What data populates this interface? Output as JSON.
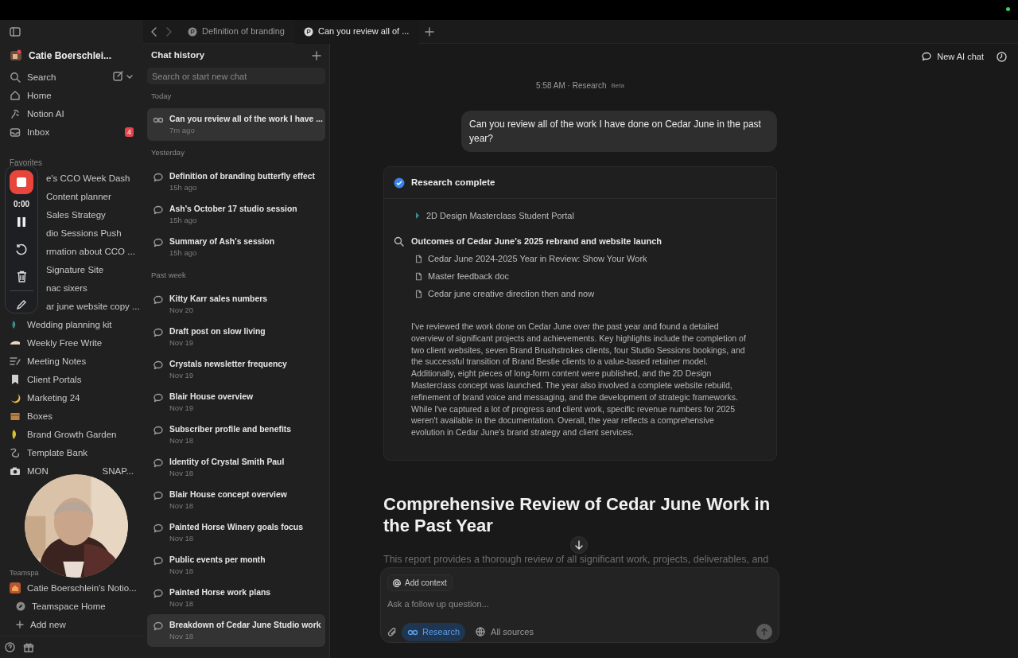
{
  "tabs": [
    {
      "label": "Definition of branding",
      "selected": false
    },
    {
      "label": "Can you review all of ...",
      "selected": true
    }
  ],
  "sidebar": {
    "workspace": "Catie Boerschlei...",
    "nav": [
      {
        "label": "Search"
      },
      {
        "label": "Home"
      },
      {
        "label": "Notion AI"
      },
      {
        "label": "Inbox",
        "badge": "4"
      }
    ],
    "favorites_heading": "Favorites",
    "favorites": [
      {
        "kind": "covered",
        "label": "e's CCO Week Dash"
      },
      {
        "kind": "covered",
        "label": "Content planner"
      },
      {
        "kind": "covered",
        "label": "Sales Strategy"
      },
      {
        "kind": "covered",
        "label": "dio Sessions Push"
      },
      {
        "kind": "covered",
        "label": "rmation about CCO ..."
      },
      {
        "kind": "covered",
        "label": "Signature Site"
      },
      {
        "kind": "covered",
        "label": "nac sixers"
      },
      {
        "kind": "covered",
        "label": "ar june website copy ..."
      },
      {
        "kind": "page",
        "label": "Wedding planning kit"
      },
      {
        "kind": "page",
        "label": "Weekly Free Write"
      },
      {
        "kind": "page",
        "label": "Meeting Notes"
      },
      {
        "kind": "page",
        "label": "Client Portals"
      },
      {
        "kind": "page",
        "label": "Marketing 24"
      },
      {
        "kind": "page",
        "label": "Boxes"
      },
      {
        "kind": "page",
        "label": "Brand Growth Garden"
      },
      {
        "kind": "page",
        "label": "Template Bank"
      },
      {
        "kind": "split",
        "label": "MON",
        "label_end": "SNAP..."
      }
    ],
    "teamspaces_heading": "Teamspa",
    "teamspaces": [
      {
        "label": "Catie Boerschlein's Notio...",
        "children": [
          {
            "label": "Teamspace Home"
          }
        ]
      }
    ],
    "add_new": "Add new"
  },
  "recorder": {
    "time": "0:00"
  },
  "chat_history": {
    "title": "Chat history",
    "search": {
      "placeholder": "Search or start new chat"
    },
    "groups": [
      {
        "heading": "Today",
        "items": [
          {
            "kind": "research",
            "title": "Can you review all of the work I have ...",
            "time": "7m ago",
            "selected": true
          }
        ]
      },
      {
        "heading": "Yesterday",
        "items": [
          {
            "kind": "chat",
            "title": "Definition of branding butterfly effect",
            "time": "15h ago",
            "selected": false
          },
          {
            "kind": "chat",
            "title": "Ash's October 17 studio session",
            "time": "15h ago",
            "selected": false
          },
          {
            "kind": "chat",
            "title": "Summary of Ash's session",
            "time": "15h ago",
            "selected": false
          }
        ]
      },
      {
        "heading": "Past week",
        "items": [
          {
            "kind": "chat",
            "title": "Kitty Karr sales numbers",
            "time": "Nov 20",
            "selected": false
          },
          {
            "kind": "chat",
            "title": "Draft post on slow living",
            "time": "Nov 19",
            "selected": false
          },
          {
            "kind": "chat",
            "title": "Crystals newsletter frequency",
            "time": "Nov 19",
            "selected": false
          },
          {
            "kind": "chat",
            "title": "Blair House overview",
            "time": "Nov 19",
            "selected": false
          },
          {
            "kind": "chat",
            "title": "Subscriber profile and benefits",
            "time": "Nov 18",
            "selected": false
          },
          {
            "kind": "chat",
            "title": "Identity of Crystal Smith Paul",
            "time": "Nov 18",
            "selected": false
          },
          {
            "kind": "chat",
            "title": "Blair House concept overview",
            "time": "Nov 18",
            "selected": false
          },
          {
            "kind": "chat",
            "title": "Painted Horse Winery goals focus",
            "time": "Nov 18",
            "selected": false
          },
          {
            "kind": "chat",
            "title": "Public events per month",
            "time": "Nov 18",
            "selected": false
          },
          {
            "kind": "chat",
            "title": "Painted Horse work plans",
            "time": "Nov 18",
            "selected": false
          },
          {
            "kind": "chat",
            "title": "Breakdown of Cedar June Studio work",
            "time": "Nov 18",
            "selected": true
          }
        ]
      }
    ]
  },
  "main": {
    "new_chat": "New AI chat",
    "meta": "5:58 AM · Research",
    "meta_badge": "Beta",
    "user_message": "Can you review all of the work I have done on Cedar June in the past year?",
    "research": {
      "status": "Research complete",
      "complete": true,
      "results": [
        {
          "kind": "page",
          "label": "2D Design Masterclass Student Portal"
        }
      ],
      "searches": [
        {
          "query": "Outcomes of Cedar June's 2025 rebrand and website launch",
          "results": [
            {
              "kind": "doc",
              "label": "Cedar June 2024-2025 Year in Review: Show Your Work"
            },
            {
              "kind": "doc",
              "label": "Master feedback doc"
            },
            {
              "kind": "doc",
              "label": "Cedar june creative direction then and now"
            }
          ]
        }
      ],
      "summary": "I've reviewed the work done on Cedar June over the past year and found a detailed overview of significant projects and achievements. Key highlights include the completion of two client websites, seven Brand Brushstrokes clients, four Studio Sessions bookings, and the successful transition of Brand Bestie clients to a value-based retainer model. Additionally, eight pieces of long-form content were published, and the 2D Design Masterclass concept was launched. The year also involved a complete website rebuild, refinement of brand voice and messaging, and the development of strategic frameworks. While I've captured a lot of progress and client work, specific revenue numbers for 2025 weren't available in the documentation. Overall, the year reflects a comprehensive evolution in Cedar June's brand strategy and client services."
    },
    "report": {
      "title": "Comprehensive Review of Cedar June Work in the Past Year",
      "intro": "This report provides a thorough review of all significant work, projects, deliverables, and"
    },
    "composer": {
      "context_chip": "Add context",
      "placeholder": "Ask a follow up question...",
      "modes": [
        {
          "kind": "research",
          "label": "Research",
          "selected": true
        },
        {
          "kind": "sources",
          "label": "All sources",
          "selected": false
        }
      ]
    }
  }
}
